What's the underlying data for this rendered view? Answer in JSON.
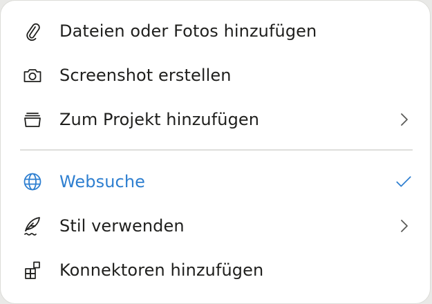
{
  "menu": {
    "items": [
      {
        "label": "Dateien oder Fotos hinzufügen",
        "icon": "paperclip-icon"
      },
      {
        "label": "Screenshot erstellen",
        "icon": "camera-icon"
      },
      {
        "label": "Zum Projekt hinzufügen",
        "icon": "project-stack-icon",
        "trailing": "chevron-right-icon"
      },
      {
        "label": "Websuche",
        "icon": "globe-icon",
        "trailing": "checkmark-icon",
        "selected": true
      },
      {
        "label": "Stil verwenden",
        "icon": "feather-pen-icon",
        "trailing": "chevron-right-icon"
      },
      {
        "label": "Konnektoren hinzufügen",
        "icon": "connectors-icon"
      }
    ]
  },
  "colors": {
    "text": "#1f1f1d",
    "accent": "#2e7fd0",
    "divider": "#dededb",
    "background": "#ffffff"
  }
}
